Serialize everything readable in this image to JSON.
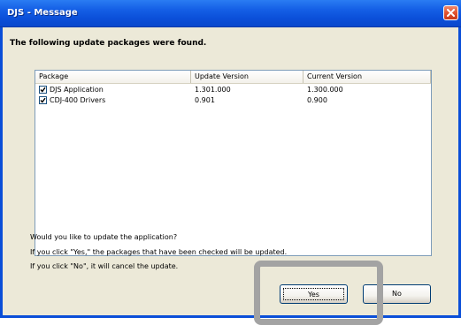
{
  "window": {
    "title": "DJS - Message"
  },
  "dialog": {
    "heading": "The following update packages were found.",
    "columns": [
      "Package",
      "Update Version",
      "Current Version"
    ],
    "rows": [
      {
        "checked": true,
        "package": "DJS Application",
        "update_version": "1.301.000",
        "current_version": "1.300.000"
      },
      {
        "checked": true,
        "package": "CDJ-400 Drivers",
        "update_version": "0.901",
        "current_version": "0.900"
      }
    ],
    "message_lines": [
      "Would you like to update the application?",
      "If you click \"Yes,\" the packages that have been checked will be updated.",
      "If you click \"No\", it will cancel the update."
    ],
    "yes_label": "Yes",
    "no_label": "No"
  },
  "colors": {
    "title_bar": "#0a4ed8",
    "dialog_bg": "#ece9d8",
    "highlight_frame": "#a3a3a3"
  },
  "icons": {
    "close": "close-icon",
    "checkbox": "checkmark-icon"
  }
}
